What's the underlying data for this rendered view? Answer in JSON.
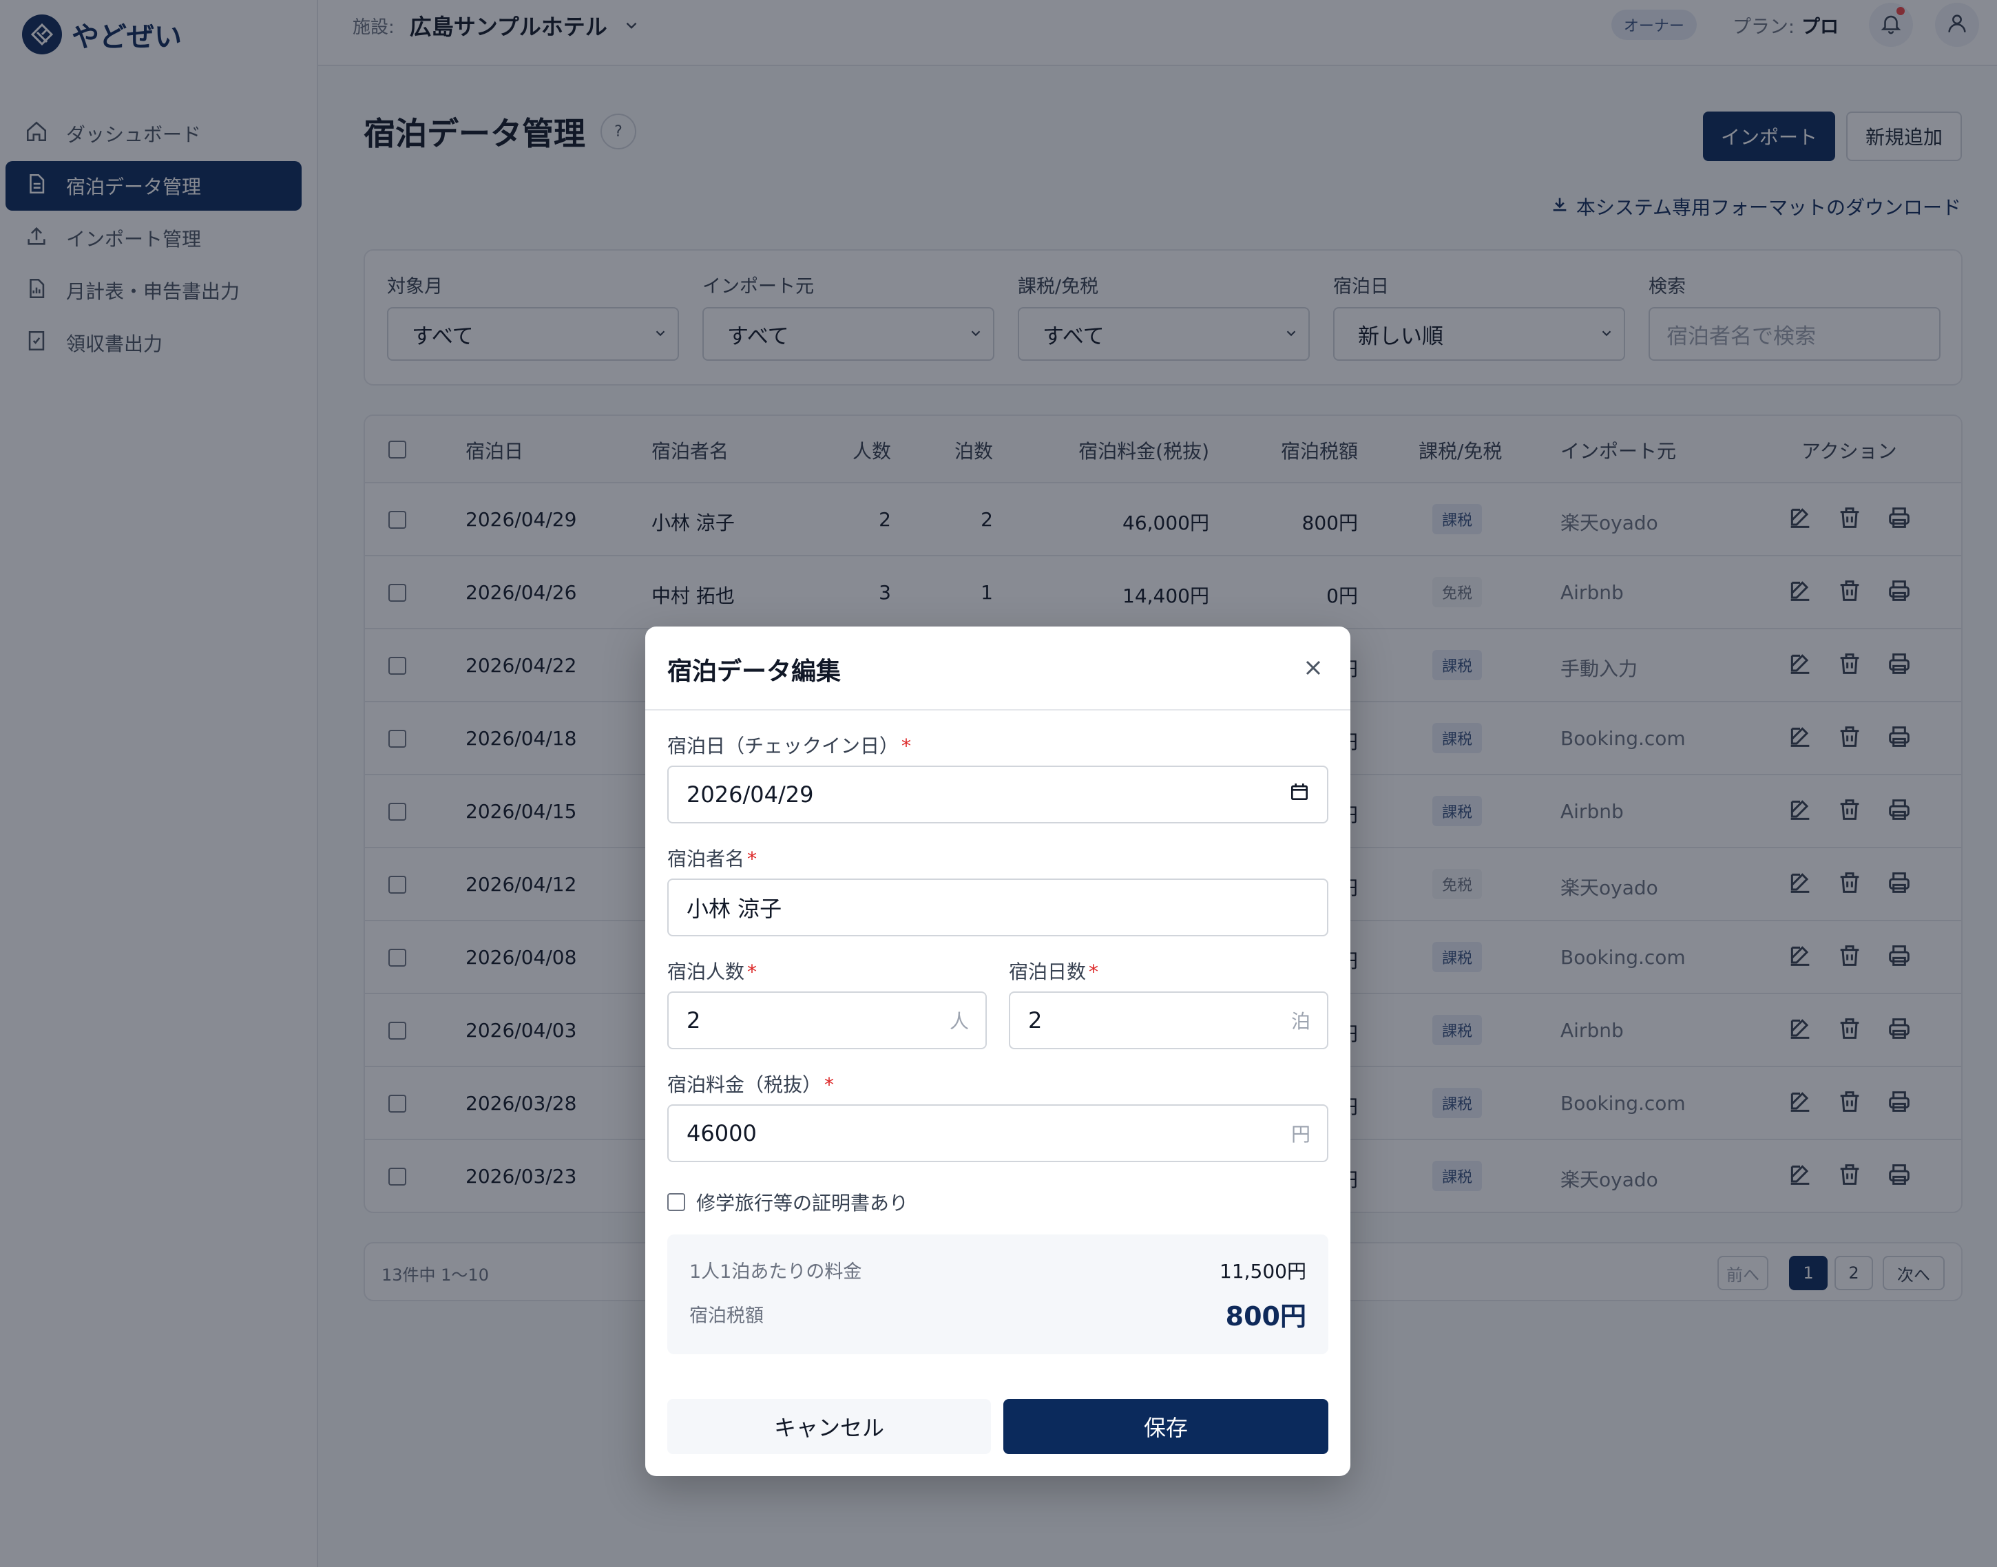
{
  "app": {
    "logo_text": "やどぜい"
  },
  "sidebar": {
    "items": [
      {
        "label": "ダッシュボード",
        "icon": "home-icon"
      },
      {
        "label": "宿泊データ管理",
        "icon": "document-icon",
        "active": true
      },
      {
        "label": "インポート管理",
        "icon": "upload-icon"
      },
      {
        "label": "月計表・申告書出力",
        "icon": "report-icon"
      },
      {
        "label": "領収書出力",
        "icon": "receipt-icon"
      }
    ]
  },
  "header": {
    "facility_label": "施設:",
    "facility_name": "広島サンプルホテル",
    "role_badge": "オーナー",
    "plan_label": "プラン:",
    "plan_value": "プロ"
  },
  "page": {
    "title": "宿泊データ管理",
    "help": "?",
    "import_button": "インポート",
    "new_button": "新規追加",
    "download_link": "本システム専用フォーマットのダウンロード"
  },
  "filters": {
    "month": {
      "label": "対象月",
      "value": "すべて"
    },
    "source": {
      "label": "インポート元",
      "value": "すべて"
    },
    "tax": {
      "label": "課税/免税",
      "value": "すべて"
    },
    "date": {
      "label": "宿泊日",
      "value": "新しい順"
    },
    "search": {
      "label": "検索",
      "placeholder": "宿泊者名で検索"
    }
  },
  "table": {
    "headers": [
      "宿泊日",
      "宿泊者名",
      "人数",
      "泊数",
      "宿泊料金(税抜)",
      "宿泊税額",
      "課税/免税",
      "インポート元",
      "アクション"
    ],
    "rows": [
      {
        "date": "2026/04/29",
        "name": "小林 涼子",
        "people": "2",
        "nights": "2",
        "fee": "46,000円",
        "tax": "800円",
        "status": "課税",
        "source": "楽天oyado"
      },
      {
        "date": "2026/04/26",
        "name": "中村 拓也",
        "people": "3",
        "nights": "1",
        "fee": "14,400円",
        "tax": "0円",
        "status": "免税",
        "source": "Airbnb"
      },
      {
        "date": "2026/04/22",
        "name": "",
        "people": "",
        "nights": "",
        "fee": "",
        "tax": "円",
        "status": "課税",
        "source": "手動入力"
      },
      {
        "date": "2026/04/18",
        "name": "",
        "people": "",
        "nights": "",
        "fee": "",
        "tax": "円",
        "status": "課税",
        "source": "Booking.com"
      },
      {
        "date": "2026/04/15",
        "name": "",
        "people": "",
        "nights": "",
        "fee": "",
        "tax": "円",
        "status": "課税",
        "source": "Airbnb"
      },
      {
        "date": "2026/04/12",
        "name": "",
        "people": "",
        "nights": "",
        "fee": "",
        "tax": "円",
        "status": "免税",
        "source": "楽天oyado"
      },
      {
        "date": "2026/04/08",
        "name": "",
        "people": "",
        "nights": "",
        "fee": "",
        "tax": "円",
        "status": "課税",
        "source": "Booking.com"
      },
      {
        "date": "2026/04/03",
        "name": "",
        "people": "",
        "nights": "",
        "fee": "",
        "tax": "円",
        "status": "課税",
        "source": "Airbnb"
      },
      {
        "date": "2026/03/28",
        "name": "",
        "people": "",
        "nights": "",
        "fee": "",
        "tax": "円",
        "status": "課税",
        "source": "Booking.com"
      },
      {
        "date": "2026/03/23",
        "name": "",
        "people": "",
        "nights": "",
        "fee": "",
        "tax": "円",
        "status": "課税",
        "source": "楽天oyado"
      }
    ]
  },
  "pagination": {
    "info": "13件中 1〜10",
    "prev": "前へ",
    "pages": [
      "1",
      "2"
    ],
    "current": "1",
    "next": "次へ"
  },
  "modal": {
    "title": "宿泊データ編集",
    "checkin_label": "宿泊日（チェックイン日）",
    "checkin_value": "2026/04/29",
    "name_label": "宿泊者名",
    "name_value": "小林 涼子",
    "people_label": "宿泊人数",
    "people_value": "2",
    "people_unit": "人",
    "nights_label": "宿泊日数",
    "nights_value": "2",
    "nights_unit": "泊",
    "fee_label": "宿泊料金（税抜）",
    "fee_value": "46000",
    "fee_unit": "円",
    "certificate_label": "修学旅行等の証明書あり",
    "certificate_checked": false,
    "per_person_label": "1人1泊あたりの料金",
    "per_person_value": "11,500円",
    "tax_label": "宿泊税額",
    "tax_value": "800円",
    "required_mark": "*",
    "cancel": "キャンセル",
    "save": "保存"
  },
  "colors": {
    "primary": "#0b2a5c",
    "required": "#dc2626",
    "notification": "#ef4444"
  }
}
